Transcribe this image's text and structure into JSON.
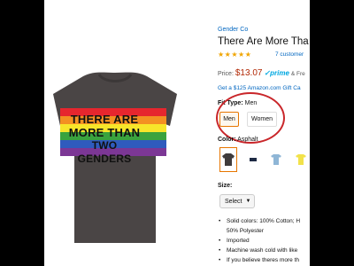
{
  "product": {
    "brand": "Gender Co",
    "title": "There Are More Tha",
    "rating_stars": "★★★★★",
    "review_count": "7 customer",
    "price_prefix": "Price:",
    "price": "$13.07",
    "prime": "✓prime",
    "shipping": "& Fre",
    "gift_card": "Get a $125 Amazon.com Gift Ca",
    "shirt_text": [
      "THERE ARE",
      "MORE THAN",
      "TWO GENDERS"
    ]
  },
  "fit": {
    "label": "Fit Type:",
    "value": "Men",
    "options": [
      "Men",
      "Women"
    ],
    "selected": "Men"
  },
  "color": {
    "label": "Color:",
    "value": "Asphalt",
    "swatches": [
      "#3f3b3b",
      "#1e2a44",
      "#8fb6d6",
      "#f2e24a"
    ]
  },
  "size": {
    "label": "Size:",
    "select_label": "Select"
  },
  "bullets": [
    "Solid colors: 100% Cotton; H",
    "50% Polyester",
    "Imported",
    "Machine wash cold with like",
    "If you believe theres more th"
  ],
  "colors": {
    "accent": "#e77600",
    "link": "#0066c0",
    "price": "#b12704",
    "circle": "#c9262a",
    "shirt": "#4a4545"
  }
}
